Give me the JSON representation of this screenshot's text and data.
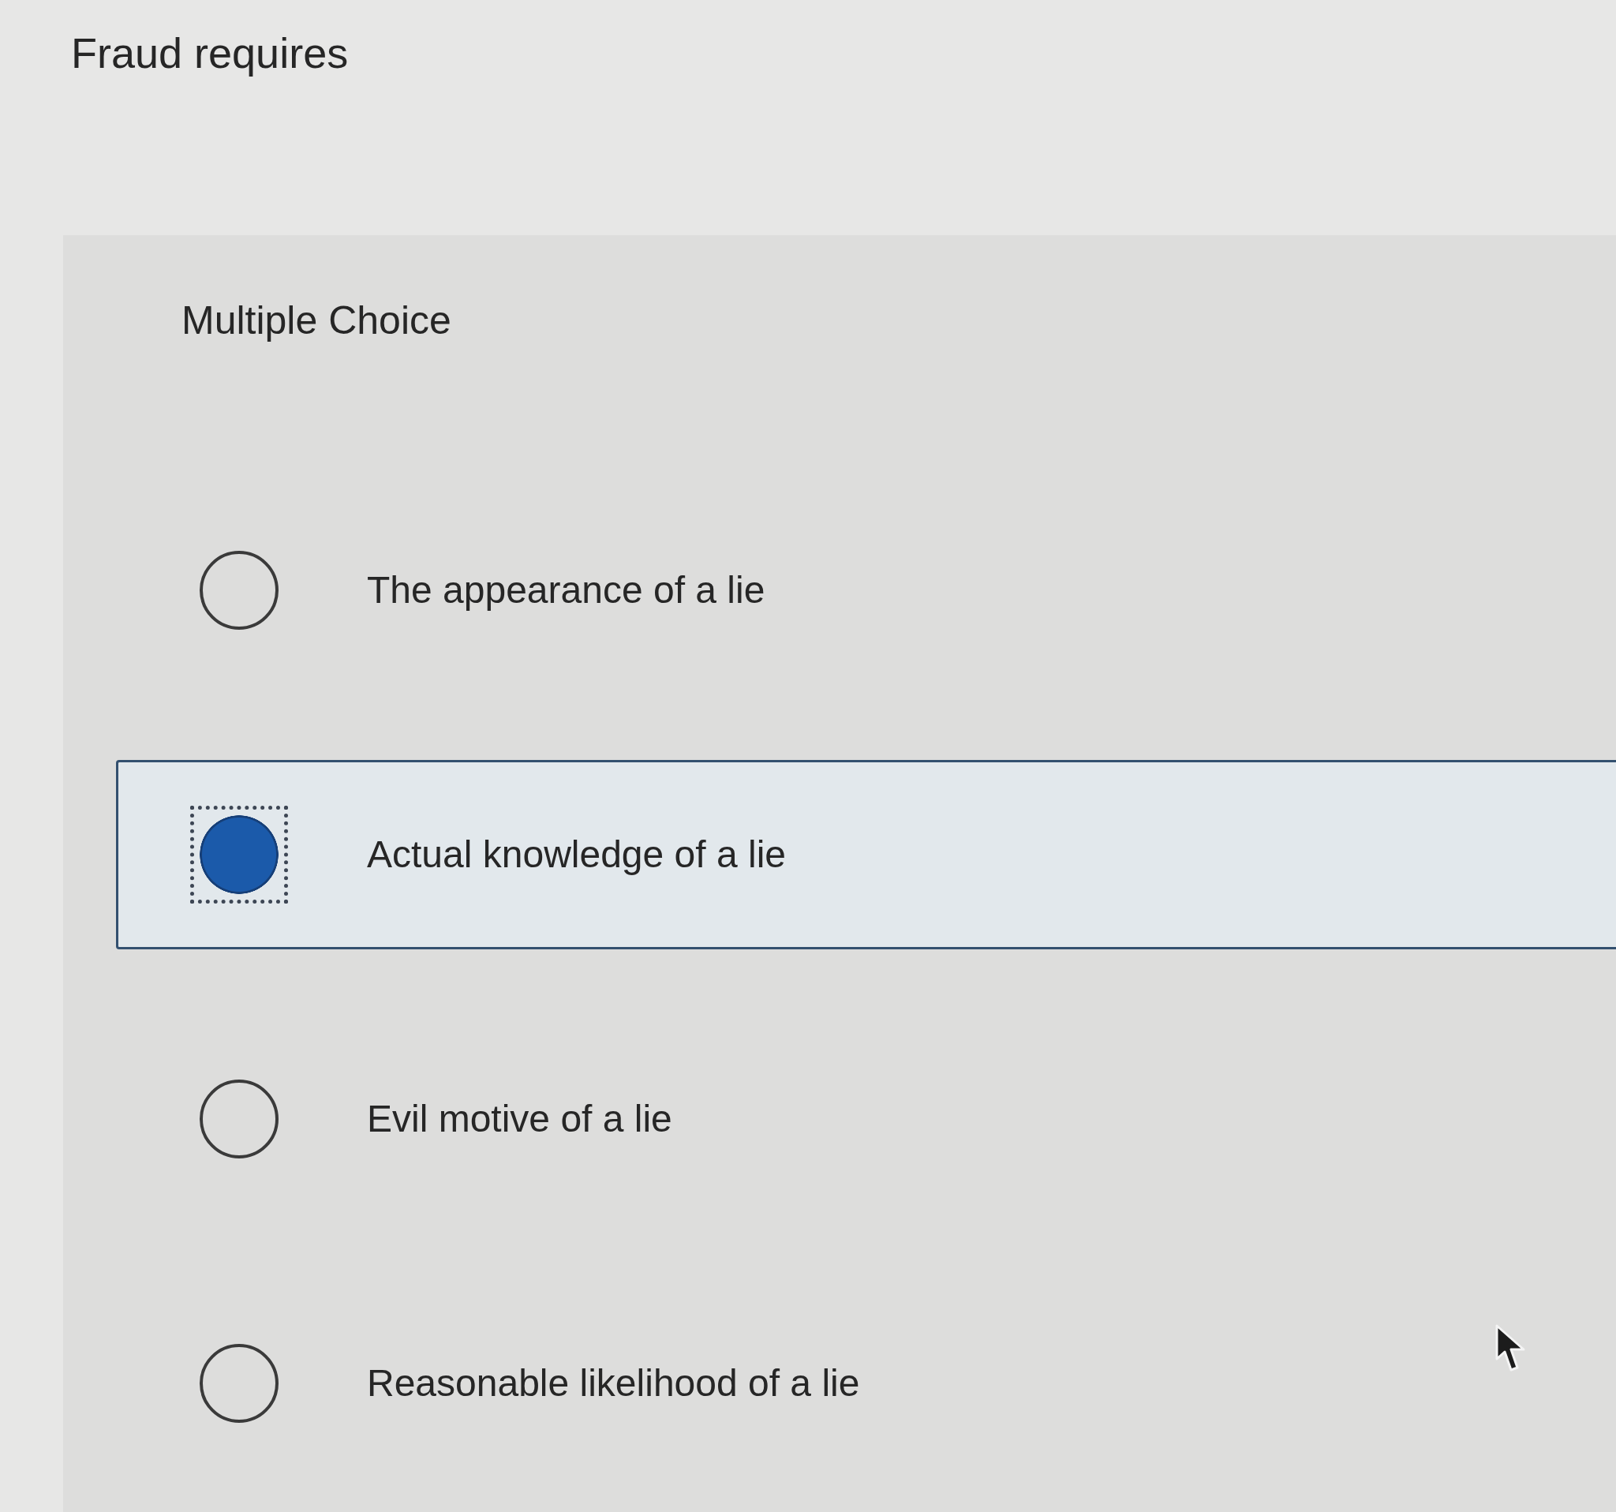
{
  "question": {
    "text": "Fraud requires"
  },
  "answer_panel": {
    "type_label": "Multiple Choice",
    "options": [
      {
        "label": "The appearance of a lie",
        "selected": false
      },
      {
        "label": "Actual knowledge of a lie",
        "selected": true
      },
      {
        "label": "Evil motive of a lie",
        "selected": false
      },
      {
        "label": "Reasonable likelihood of a lie",
        "selected": false
      }
    ]
  }
}
